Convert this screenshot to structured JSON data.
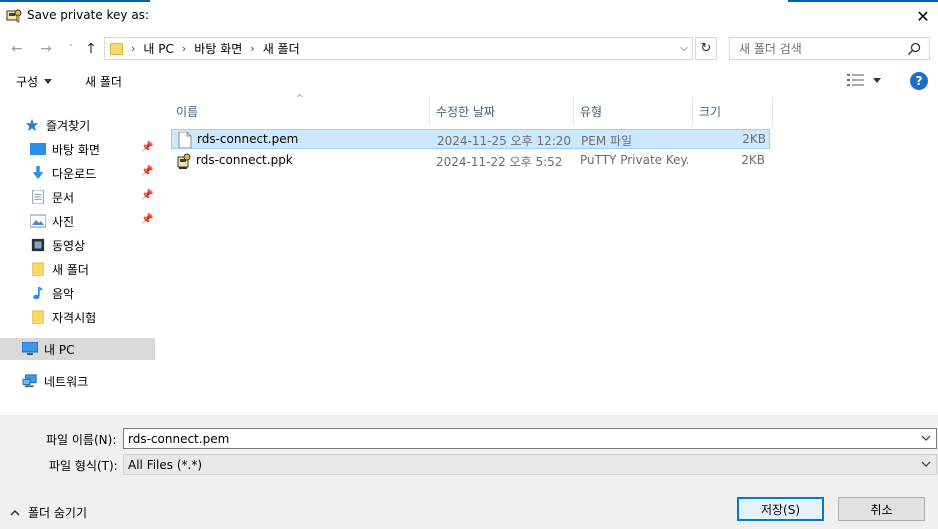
{
  "window": {
    "title": "Save private key as:",
    "close_label": "✕"
  },
  "nav": {
    "back": "←",
    "forward": "→",
    "recent": "˅",
    "up": "↑"
  },
  "address": {
    "breadcrumbs": [
      "내 PC",
      "바탕 화면",
      "새 폴더"
    ],
    "dropdown": "⌵",
    "refresh": "↻"
  },
  "search": {
    "placeholder": "새 폴더 검색"
  },
  "toolbar": {
    "organize_label": "구성",
    "new_folder_label": "새 폴더",
    "help_label": "?"
  },
  "sidebar": {
    "items": [
      {
        "label": "즐겨찾기",
        "icon": "star-icon",
        "pinned": false
      },
      {
        "label": "바탕 화면",
        "icon": "desktop-icon",
        "pinned": true
      },
      {
        "label": "다운로드",
        "icon": "download-icon",
        "pinned": true
      },
      {
        "label": "문서",
        "icon": "document-icon",
        "pinned": true
      },
      {
        "label": "사진",
        "icon": "pictures-icon",
        "pinned": true
      },
      {
        "label": "동영상",
        "icon": "video-icon",
        "pinned": false
      },
      {
        "label": "새 폴더",
        "icon": "folder-icon",
        "pinned": false
      },
      {
        "label": "음악",
        "icon": "music-icon",
        "pinned": false
      },
      {
        "label": "자격시험",
        "icon": "folder-icon",
        "pinned": false
      },
      {
        "label": "내 PC",
        "icon": "computer-icon",
        "pinned": false
      },
      {
        "label": "네트워크",
        "icon": "network-icon",
        "pinned": false
      }
    ]
  },
  "files": {
    "columns": [
      "이름",
      "수정한 날짜",
      "유형",
      "크기"
    ],
    "rows": [
      {
        "name": "rds-connect.pem",
        "modified": "2024-11-25 오후 12:20",
        "type": "PEM 파일",
        "size": "2KB",
        "icon": "file-icon"
      },
      {
        "name": "rds-connect.ppk",
        "modified": "2024-11-22 오후 5:52",
        "type": "PuTTY Private Key...",
        "size": "2KB",
        "icon": "putty-key-icon"
      }
    ]
  },
  "form": {
    "filename_label": "파일 이름(N):",
    "filename_value": "rds-connect.pem",
    "filetype_label": "파일 형식(T):",
    "filetype_value": "All Files (*.*)"
  },
  "footer": {
    "hide_folders_label": "폴더 숨기기",
    "save_label": "저장(S)",
    "cancel_label": "취소"
  },
  "colors": {
    "accent": "#0063b1",
    "selection_bg": "#cce8ff",
    "selection_border": "#99d1ff",
    "sidebar_selected": "#d9d9d9",
    "bottom_panel": "#f0f0f0"
  }
}
